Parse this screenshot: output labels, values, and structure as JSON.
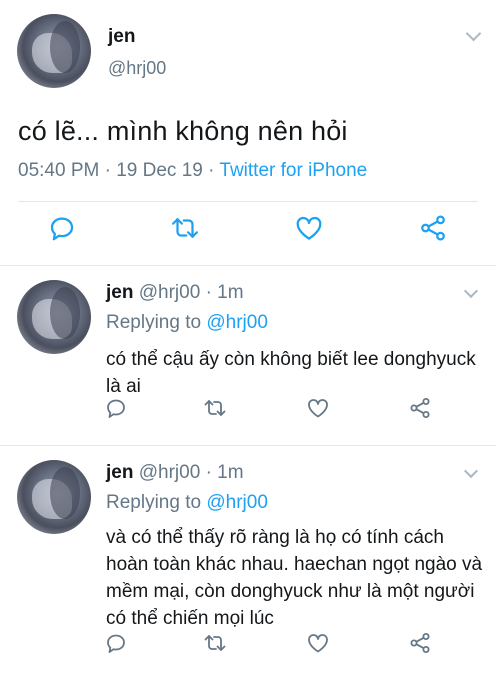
{
  "main": {
    "name": "jen",
    "handle": "@hrj00",
    "text": "có lẽ... mình không nên hỏi",
    "time": "05:40 PM",
    "date": "19 Dec 19",
    "source": "Twitter for iPhone",
    "sep": "·"
  },
  "replies": [
    {
      "name": "jen",
      "handle": "@hrj00",
      "age": "1m",
      "replying_label": "Replying to",
      "replying_to": "@hrj00",
      "text": "có thể cậu ấy còn không biết lee donghyuck là ai"
    },
    {
      "name": "jen",
      "handle": "@hrj00",
      "age": "1m",
      "replying_label": "Replying to",
      "replying_to": "@hrj00",
      "text": "và có thể thấy rõ ràng là họ có tính cách hoàn toàn khác nhau. haechan ngọt ngào và mềm mại, còn donghyuck như là một người có thể chiến mọi lúc"
    }
  ],
  "icons": [
    "reply-icon",
    "retweet-icon",
    "like-icon",
    "share-icon",
    "chevron-down-icon"
  ],
  "colors": {
    "accent": "#1da1f2",
    "secondary_text": "#657786",
    "icon": "#1da1f2",
    "border": "#e1e8ed"
  }
}
